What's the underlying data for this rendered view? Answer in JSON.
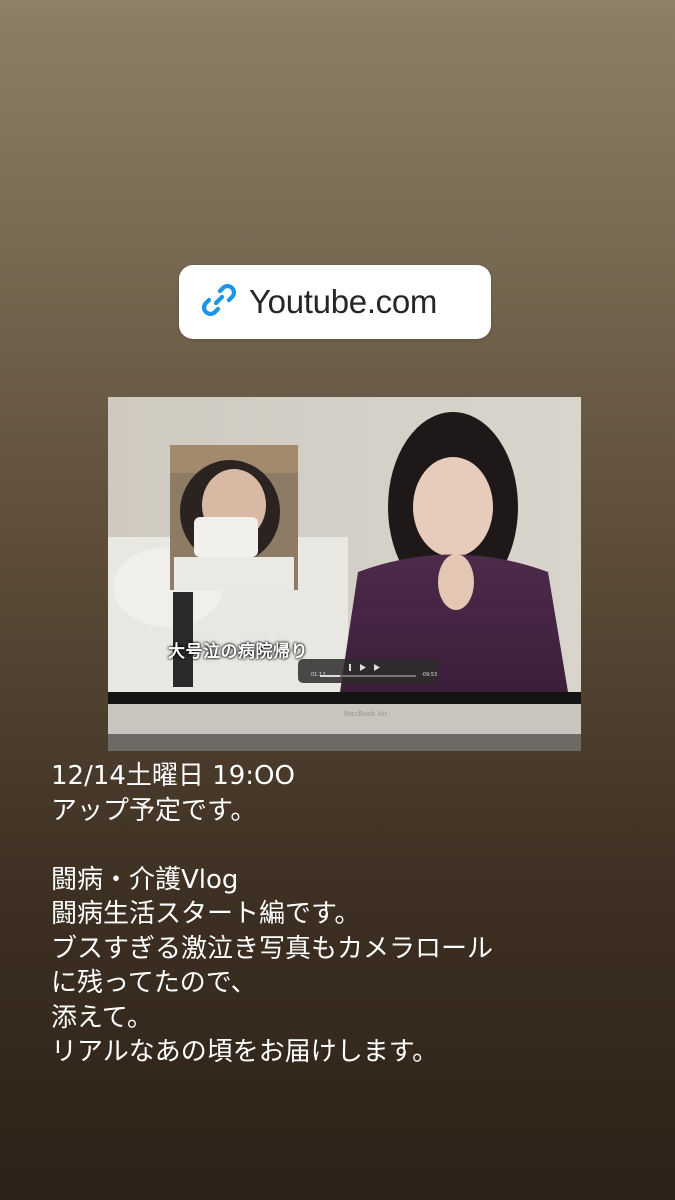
{
  "link_sticker": {
    "icon": "link-icon",
    "text": "Youtube.com"
  },
  "photo": {
    "subtitle": "大号泣の病院帰り",
    "player_time_current": "01:12",
    "player_time_remaining": "-09:53",
    "laptop_brand": "MacBook Air"
  },
  "caption": {
    "lines": [
      "12/14土曜日 19:OO",
      "アップ予定です。",
      "",
      "闘病・介護Vlog",
      "闘病生活スタート編です。",
      "ブスすぎる激泣き写真もカメラロール",
      "に残ってたので、",
      "添えて。",
      "リアルなあの頃をお届けします。"
    ]
  },
  "colors": {
    "link_icon_blue": "#1c95e8",
    "sticker_bg": "#ffffff",
    "caption_text": "#ffffff"
  }
}
